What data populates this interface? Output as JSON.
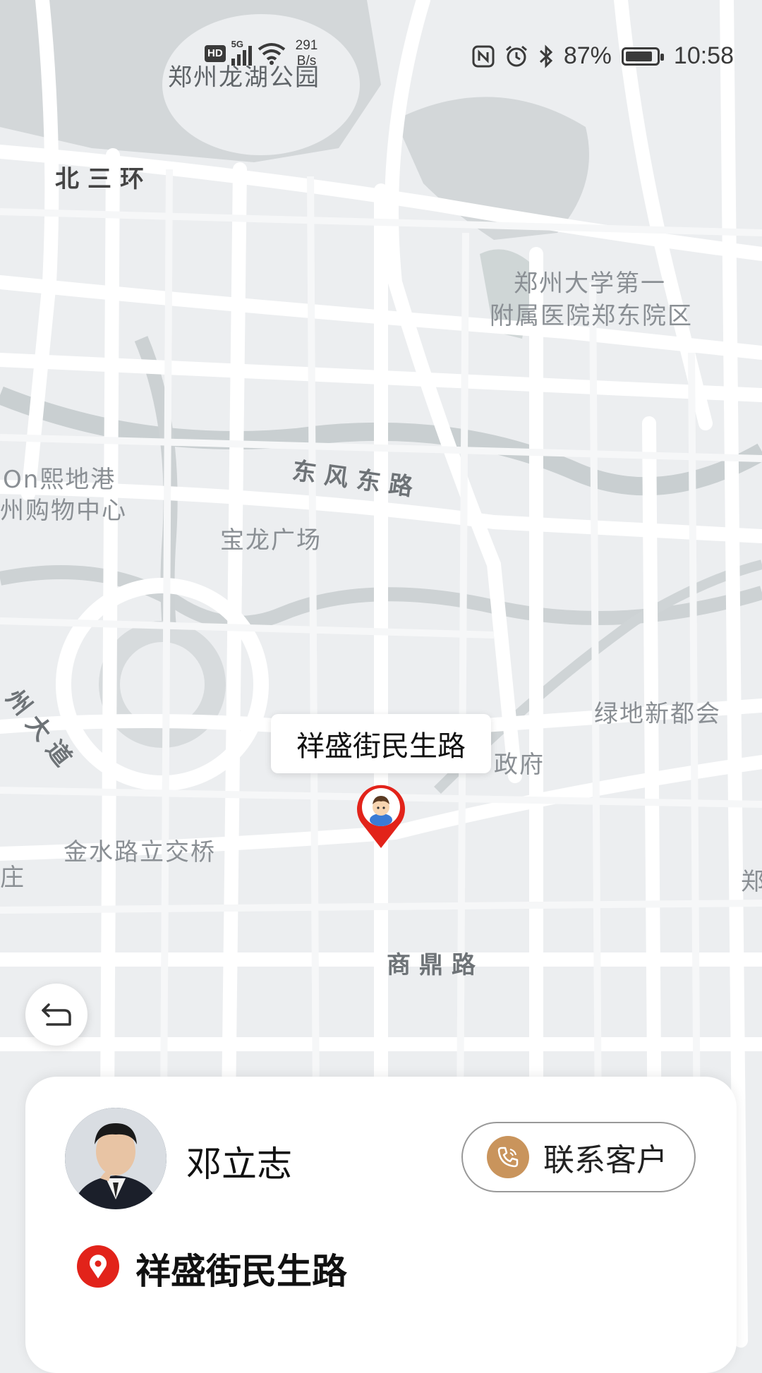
{
  "status_bar": {
    "hd": "HD",
    "network": "5G",
    "speed_value": "291",
    "speed_unit": "B/s",
    "battery": "87%",
    "battery_level": 0.87,
    "time": "10:58"
  },
  "map": {
    "labels": {
      "park": "郑州龙湖公园",
      "ring_road": "北三环",
      "hospital_line1": "郑州大学第一",
      "hospital_line2": "附属医院郑东院区",
      "mall_line1": "On熙地港",
      "mall_line2": "州购物中心",
      "dongfeng_road": "东风东路",
      "baolong": "宝龙广场",
      "avenue": "州大道",
      "greenland": "绿地新都会",
      "government": "政府",
      "jinshui_bridge": "金水路立交桥",
      "zhuang": "庄",
      "zheng": "郑",
      "shangding_road": "商鼎路"
    },
    "marker_callout": "祥盛街民生路"
  },
  "card": {
    "customer_name": "邓立志",
    "contact_button": "联系客户",
    "address": "祥盛街民生路"
  },
  "icons": {
    "back": "back-arrow-icon",
    "phone": "phone-icon",
    "location": "location-pin-icon"
  },
  "colors": {
    "pin_red": "#e2231a",
    "phone_accent": "#c9945c"
  }
}
